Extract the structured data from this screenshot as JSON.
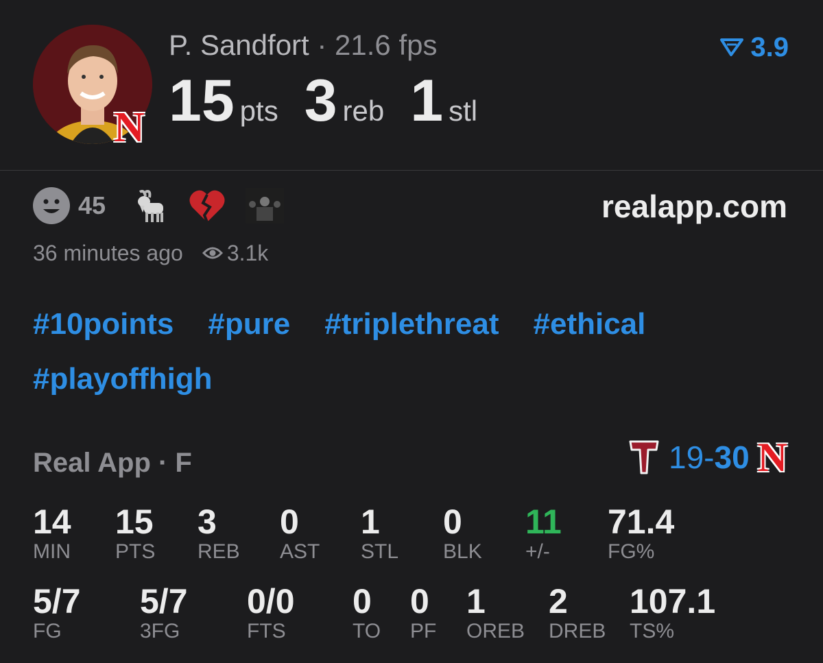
{
  "player": {
    "name": "P. Sandfort",
    "separator": " · ",
    "fps": "21.6 fps",
    "rating": "3.9"
  },
  "headline_stats": [
    {
      "value": "15",
      "unit": "pts"
    },
    {
      "value": "3",
      "unit": "reb"
    },
    {
      "value": "1",
      "unit": "stl"
    }
  ],
  "reactions": {
    "count": "45",
    "icons": [
      "smiley-face-icon",
      "goat-icon",
      "broken-heart-icon",
      "reaction-gif-thumbnail"
    ]
  },
  "site": "realapp.com",
  "meta": {
    "time_ago": "36 minutes ago",
    "views": "3.1k"
  },
  "hashtags": [
    "#10points",
    "#pure",
    "#triplethreat",
    "#ethical",
    "#playoffhigh"
  ],
  "game": {
    "title": "Real App · F",
    "away_score": "19",
    "dash": "-",
    "home_score": "30"
  },
  "stats_row1": [
    {
      "value": "14",
      "label": "MIN"
    },
    {
      "value": "15",
      "label": "PTS"
    },
    {
      "value": "3",
      "label": "REB"
    },
    {
      "value": "0",
      "label": "AST"
    },
    {
      "value": "1",
      "label": "STL"
    },
    {
      "value": "0",
      "label": "BLK"
    },
    {
      "value": "11",
      "label": "+/-"
    },
    {
      "value": "71.4",
      "label": "FG%"
    }
  ],
  "stats_row2": [
    {
      "value": "5/7",
      "label": "FG"
    },
    {
      "value": "5/7",
      "label": "3FG"
    },
    {
      "value": "0/0",
      "label": "FTS"
    },
    {
      "value": "0",
      "label": "TO"
    },
    {
      "value": "0",
      "label": "PF"
    },
    {
      "value": "1",
      "label": "OREB"
    },
    {
      "value": "2",
      "label": "DREB"
    },
    {
      "value": "107.1",
      "label": "TS%"
    }
  ],
  "colors": {
    "accent": "#2e8ee4",
    "positive": "#2fb559",
    "nebraska_red": "#e41c23",
    "background": "#1c1c1e"
  }
}
